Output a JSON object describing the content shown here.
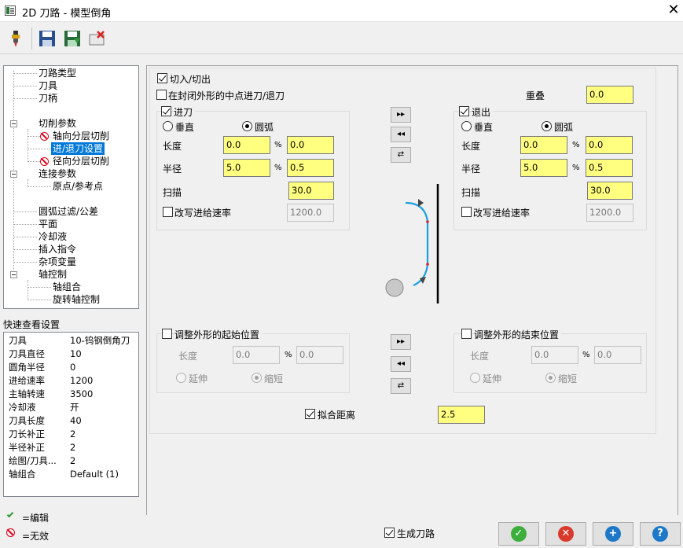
{
  "window": {
    "title": "2D 刀路 - 模型倒角"
  },
  "tree": {
    "items": [
      {
        "label": "刀路类型"
      },
      {
        "label": "刀具"
      },
      {
        "label": "刀柄"
      },
      {
        "label": "切削参数"
      },
      {
        "label": "轴向分层切削"
      },
      {
        "label": "进/退刀设置"
      },
      {
        "label": "径向分层切削"
      },
      {
        "label": "连接参数"
      },
      {
        "label": "原点/参考点"
      },
      {
        "label": "圆弧过滤/公差"
      },
      {
        "label": "平面"
      },
      {
        "label": "冷却液"
      },
      {
        "label": "插入指令"
      },
      {
        "label": "杂项变量"
      },
      {
        "label": "轴控制"
      },
      {
        "label": "轴组合"
      },
      {
        "label": "旋转轴控制"
      }
    ]
  },
  "quick_view": {
    "title": "快速查看设置",
    "rows": [
      {
        "k": "刀具",
        "v": "10-钨钢倒角刀"
      },
      {
        "k": "刀具直径",
        "v": "10"
      },
      {
        "k": "圆角半径",
        "v": "0"
      },
      {
        "k": "进给速率",
        "v": "1200"
      },
      {
        "k": "主轴转速",
        "v": "3500"
      },
      {
        "k": "冷却液",
        "v": "开"
      },
      {
        "k": "刀具长度",
        "v": "40"
      },
      {
        "k": "刀长补正",
        "v": "2"
      },
      {
        "k": "半径补正",
        "v": "2"
      },
      {
        "k": "绘图/刀具...",
        "v": "2"
      },
      {
        "k": "轴组合",
        "v": "Default (1)"
      }
    ]
  },
  "legend": {
    "edit": "=编辑",
    "invalid": "=无效"
  },
  "main": {
    "enter_exit": "切入/切出",
    "closed_mid": "在封闭外形的中点进刀/退刀",
    "overlap_label": "重叠",
    "overlap_value": "0.0",
    "entry": {
      "title": "进刀",
      "vertical": "垂直",
      "arc": "圆弧",
      "length_label": "长度",
      "length_value": "0.0",
      "length_pct": "0.0",
      "radius_label": "半径",
      "radius_value": "5.0",
      "radius_pct": "0.5",
      "sweep_label": "扫描",
      "sweep_value": "30.0",
      "feed_override": "改写进给速率",
      "feed_value": "1200.0"
    },
    "exit": {
      "title": "退出",
      "vertical": "垂直",
      "arc": "圆弧",
      "length_label": "长度",
      "length_value": "0.0",
      "length_pct": "0.0",
      "radius_label": "半径",
      "radius_value": "5.0",
      "radius_pct": "0.5",
      "sweep_label": "扫描",
      "sweep_value": "30.0",
      "feed_override": "改写进给速率",
      "feed_value": "1200.0"
    },
    "pct": "%",
    "adjust_start": {
      "title": "调整外形的起始位置",
      "length_label": "长度",
      "length_value": "0.0",
      "pct_value": "0.0",
      "extend": "延伸",
      "shorten": "缩短"
    },
    "adjust_end": {
      "title": "调整外形的结束位置",
      "length_label": "长度",
      "length_value": "0.0",
      "pct_value": "0.0",
      "extend": "延伸",
      "shorten": "缩短"
    },
    "fit_distance_label": "拟合距离",
    "fit_distance_value": "2.5",
    "generate_toolpath": "生成刀路"
  },
  "icons": {
    "toolbar": [
      "tool-icon",
      "save-icon",
      "save-as-icon",
      "delete-icon"
    ],
    "buttons": [
      "ok-icon",
      "cancel-icon",
      "add-icon",
      "help-icon"
    ]
  },
  "colors": {
    "input_bg": "#ffff80",
    "selection": "#0078d7",
    "ok": "#3cae3c",
    "cancel": "#d93a2b",
    "add": "#1e78c8",
    "help": "#1e78c8"
  }
}
